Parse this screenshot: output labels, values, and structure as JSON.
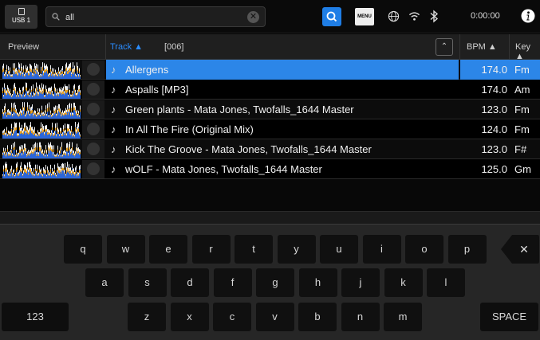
{
  "topbar": {
    "usb_label": "USB 1",
    "search_value": "all",
    "clear_glyph": "✕",
    "menu_label": "MENU",
    "time": "0:00:00",
    "icons": [
      "usb-icon",
      "search-icon",
      "clear-icon",
      "menu-icon",
      "globe-icon",
      "wifi-icon",
      "bluetooth-icon",
      "info-icon"
    ]
  },
  "table": {
    "header": {
      "preview": "Preview",
      "track": "Track ▲",
      "count": "[006]",
      "sort_glyph": "⌃",
      "bpm": "BPM ▲",
      "key": "Key ▲"
    },
    "rows": [
      {
        "title": "Allergens",
        "bpm": "174.0",
        "key": "Fm",
        "selected": true
      },
      {
        "title": "Aspalls [MP3]",
        "bpm": "174.0",
        "key": "Am",
        "selected": false
      },
      {
        "title": "Green plants - Mata Jones, Twofalls_1644 Master",
        "bpm": "123.0",
        "key": "Fm",
        "selected": false
      },
      {
        "title": "In All The Fire (Original Mix)",
        "bpm": "124.0",
        "key": "Fm",
        "selected": false
      },
      {
        "title": "Kick The Groove - Mata Jones, Twofalls_1644 Master",
        "bpm": "123.0",
        "key": "F#",
        "selected": false
      },
      {
        "title": "wOLF - Mata Jones, Twofalls_1644 Master",
        "bpm": "125.0",
        "key": "Gm",
        "selected": false
      }
    ],
    "note_glyph": "♪"
  },
  "keyboard": {
    "row1": [
      "q",
      "w",
      "e",
      "r",
      "t",
      "y",
      "u",
      "i",
      "o",
      "p"
    ],
    "row2": [
      "a",
      "s",
      "d",
      "f",
      "g",
      "h",
      "j",
      "k",
      "l"
    ],
    "row3": [
      "z",
      "x",
      "c",
      "v",
      "b",
      "n",
      "m"
    ],
    "numbers_label": "123",
    "space_label": "SPACE",
    "backspace_glyph": "✕"
  },
  "colors": {
    "accent": "#2c86e8",
    "waveform_blue": "#2b66d9",
    "waveform_orange": "#e8a020",
    "waveform_white": "#f2f2f2"
  }
}
